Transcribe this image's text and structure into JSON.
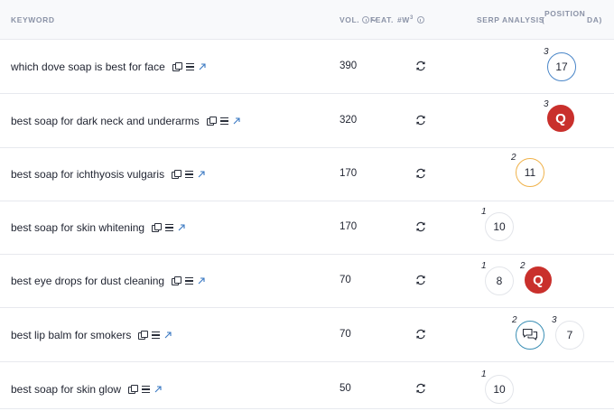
{
  "header": {
    "keyword": "KEYWORD",
    "vol": "VOL.",
    "feat": "FEAT.",
    "w_label": "#W",
    "w_sup": "3",
    "serp": "SERP ANALYSIS",
    "paren": "(",
    "position": "POSITION",
    "da": "DA)"
  },
  "colors": {
    "quora": "#c9302c",
    "blue_ring": "#4a86c8",
    "orange_ring": "#f0b24a",
    "teal_ring": "#3b8fb5"
  },
  "rows": [
    {
      "keyword": "which dove soap is best for face",
      "vol": "390",
      "serp": [
        {
          "rank": "3",
          "type": "number",
          "value": "17",
          "ring": "blue"
        }
      ]
    },
    {
      "keyword": "best soap for dark neck and underarms",
      "vol": "320",
      "serp": [
        {
          "rank": "3",
          "type": "quora",
          "value": "Q"
        }
      ]
    },
    {
      "keyword": "best soap for ichthyosis vulgaris",
      "vol": "170",
      "serp": [
        {
          "rank": "2",
          "type": "number",
          "value": "11",
          "ring": "orange"
        }
      ]
    },
    {
      "keyword": "best soap for skin whitening",
      "vol": "170",
      "serp": [
        {
          "rank": "1",
          "type": "number",
          "value": "10"
        }
      ]
    },
    {
      "keyword": "best eye drops for dust cleaning",
      "vol": "70",
      "serp": [
        {
          "rank": "1",
          "type": "number",
          "value": "8"
        },
        {
          "rank": "2",
          "type": "quora",
          "value": "Q"
        }
      ]
    },
    {
      "keyword": "best lip balm for smokers",
      "vol": "70",
      "serp": [
        {
          "rank": "2",
          "type": "forum",
          "icon": "chat-bubbles-icon",
          "ring": "teal"
        },
        {
          "rank": "3",
          "type": "number",
          "value": "7"
        }
      ]
    },
    {
      "keyword": "best soap for skin glow",
      "vol": "50",
      "serp": [
        {
          "rank": "1",
          "type": "number",
          "value": "10"
        }
      ]
    }
  ]
}
